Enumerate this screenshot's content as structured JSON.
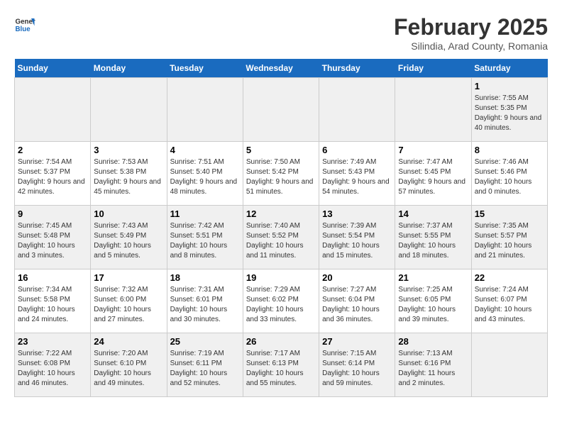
{
  "logo": {
    "general": "General",
    "blue": "Blue"
  },
  "title": "February 2025",
  "location": "Silindia, Arad County, Romania",
  "days_of_week": [
    "Sunday",
    "Monday",
    "Tuesday",
    "Wednesday",
    "Thursday",
    "Friday",
    "Saturday"
  ],
  "weeks": [
    [
      {
        "day": "",
        "info": ""
      },
      {
        "day": "",
        "info": ""
      },
      {
        "day": "",
        "info": ""
      },
      {
        "day": "",
        "info": ""
      },
      {
        "day": "",
        "info": ""
      },
      {
        "day": "",
        "info": ""
      },
      {
        "day": "1",
        "info": "Sunrise: 7:55 AM\nSunset: 5:35 PM\nDaylight: 9 hours and 40 minutes."
      }
    ],
    [
      {
        "day": "2",
        "info": "Sunrise: 7:54 AM\nSunset: 5:37 PM\nDaylight: 9 hours and 42 minutes."
      },
      {
        "day": "3",
        "info": "Sunrise: 7:53 AM\nSunset: 5:38 PM\nDaylight: 9 hours and 45 minutes."
      },
      {
        "day": "4",
        "info": "Sunrise: 7:51 AM\nSunset: 5:40 PM\nDaylight: 9 hours and 48 minutes."
      },
      {
        "day": "5",
        "info": "Sunrise: 7:50 AM\nSunset: 5:42 PM\nDaylight: 9 hours and 51 minutes."
      },
      {
        "day": "6",
        "info": "Sunrise: 7:49 AM\nSunset: 5:43 PM\nDaylight: 9 hours and 54 minutes."
      },
      {
        "day": "7",
        "info": "Sunrise: 7:47 AM\nSunset: 5:45 PM\nDaylight: 9 hours and 57 minutes."
      },
      {
        "day": "8",
        "info": "Sunrise: 7:46 AM\nSunset: 5:46 PM\nDaylight: 10 hours and 0 minutes."
      }
    ],
    [
      {
        "day": "9",
        "info": "Sunrise: 7:45 AM\nSunset: 5:48 PM\nDaylight: 10 hours and 3 minutes."
      },
      {
        "day": "10",
        "info": "Sunrise: 7:43 AM\nSunset: 5:49 PM\nDaylight: 10 hours and 5 minutes."
      },
      {
        "day": "11",
        "info": "Sunrise: 7:42 AM\nSunset: 5:51 PM\nDaylight: 10 hours and 8 minutes."
      },
      {
        "day": "12",
        "info": "Sunrise: 7:40 AM\nSunset: 5:52 PM\nDaylight: 10 hours and 11 minutes."
      },
      {
        "day": "13",
        "info": "Sunrise: 7:39 AM\nSunset: 5:54 PM\nDaylight: 10 hours and 15 minutes."
      },
      {
        "day": "14",
        "info": "Sunrise: 7:37 AM\nSunset: 5:55 PM\nDaylight: 10 hours and 18 minutes."
      },
      {
        "day": "15",
        "info": "Sunrise: 7:35 AM\nSunset: 5:57 PM\nDaylight: 10 hours and 21 minutes."
      }
    ],
    [
      {
        "day": "16",
        "info": "Sunrise: 7:34 AM\nSunset: 5:58 PM\nDaylight: 10 hours and 24 minutes."
      },
      {
        "day": "17",
        "info": "Sunrise: 7:32 AM\nSunset: 6:00 PM\nDaylight: 10 hours and 27 minutes."
      },
      {
        "day": "18",
        "info": "Sunrise: 7:31 AM\nSunset: 6:01 PM\nDaylight: 10 hours and 30 minutes."
      },
      {
        "day": "19",
        "info": "Sunrise: 7:29 AM\nSunset: 6:02 PM\nDaylight: 10 hours and 33 minutes."
      },
      {
        "day": "20",
        "info": "Sunrise: 7:27 AM\nSunset: 6:04 PM\nDaylight: 10 hours and 36 minutes."
      },
      {
        "day": "21",
        "info": "Sunrise: 7:25 AM\nSunset: 6:05 PM\nDaylight: 10 hours and 39 minutes."
      },
      {
        "day": "22",
        "info": "Sunrise: 7:24 AM\nSunset: 6:07 PM\nDaylight: 10 hours and 43 minutes."
      }
    ],
    [
      {
        "day": "23",
        "info": "Sunrise: 7:22 AM\nSunset: 6:08 PM\nDaylight: 10 hours and 46 minutes."
      },
      {
        "day": "24",
        "info": "Sunrise: 7:20 AM\nSunset: 6:10 PM\nDaylight: 10 hours and 49 minutes."
      },
      {
        "day": "25",
        "info": "Sunrise: 7:19 AM\nSunset: 6:11 PM\nDaylight: 10 hours and 52 minutes."
      },
      {
        "day": "26",
        "info": "Sunrise: 7:17 AM\nSunset: 6:13 PM\nDaylight: 10 hours and 55 minutes."
      },
      {
        "day": "27",
        "info": "Sunrise: 7:15 AM\nSunset: 6:14 PM\nDaylight: 10 hours and 59 minutes."
      },
      {
        "day": "28",
        "info": "Sunrise: 7:13 AM\nSunset: 6:16 PM\nDaylight: 11 hours and 2 minutes."
      },
      {
        "day": "",
        "info": ""
      }
    ]
  ],
  "shaded_rows": [
    0,
    2,
    4
  ]
}
